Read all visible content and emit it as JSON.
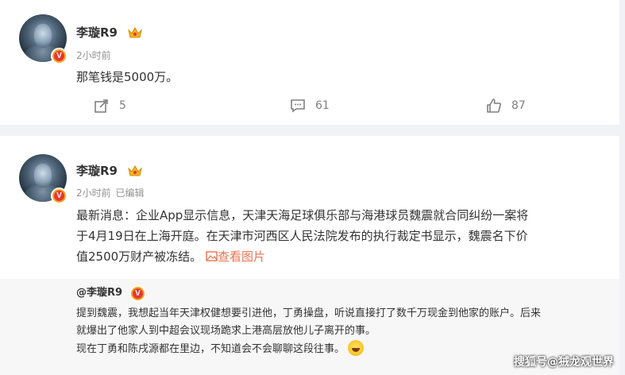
{
  "post1": {
    "username": "李璇R9",
    "verified_badge": "V",
    "time": "2小时前",
    "text": "那笔钱是5000万。",
    "actions": {
      "repost_count": "5",
      "comment_count": "61",
      "like_count": "87"
    }
  },
  "post2": {
    "username": "李璇R9",
    "verified_badge": "V",
    "time": "2小时前",
    "edited": "已编辑",
    "text_line1": "最新消息：企业App显示信息，天津天海足球俱乐部与海港球员魏震就合同纠纷一案将",
    "text_line2": "于4月19日在上海开庭。在天津市河西区人民法院发布的执行裁定书显示，魏震名下价",
    "text_line3": "值2500万财产被冻结。",
    "view_image_label": "查看图片"
  },
  "quote": {
    "username": "@李璇R9",
    "verified_badge": "V",
    "line1": "提到魏震，我想起当年天津权健想要引进他，丁勇操盘，听说直接打了数千万现金到他家的账户。后来",
    "line2": "就爆出了他家人到中超会议现场跪求上港高层放他儿子离开的事。",
    "line3": "现在丁勇和陈戌源都在里边，不知道会不会聊聊这段往事。"
  },
  "watermark": "搜狐号@狨龙观世界",
  "icons": {
    "crown": "crown-icon",
    "repost": "repost-icon",
    "comment": "comment-icon",
    "like": "like-icon",
    "image": "image-icon",
    "emoji": "laugh-cry-emoji"
  },
  "colors": {
    "link": "#eb7350",
    "meta": "#939393",
    "badge": "#e8372c",
    "background": "#f1f2f5"
  }
}
